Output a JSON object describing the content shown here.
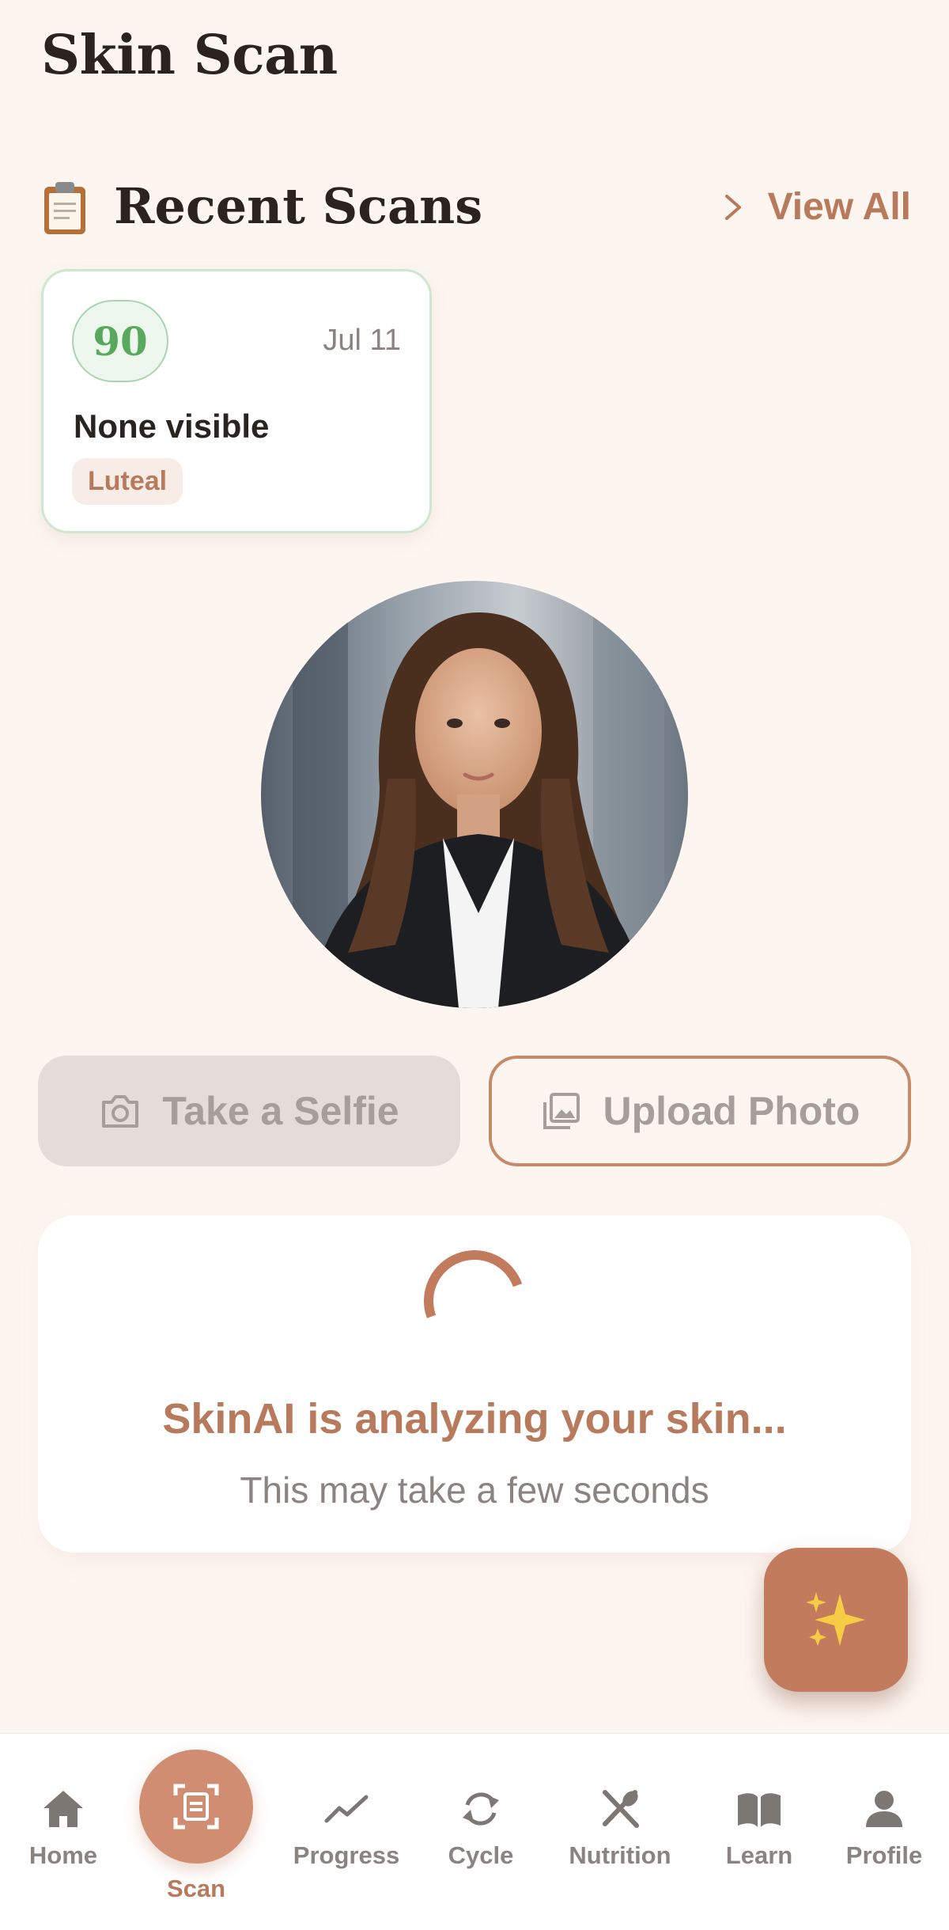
{
  "header": {
    "title": "Skin Scan"
  },
  "recent_scans": {
    "title": "Recent Scans",
    "icon": "clipboard-icon",
    "view_all_label": "View All",
    "items": [
      {
        "score": "90",
        "date": "Jul 11",
        "label": "None visible",
        "phase": "Luteal"
      }
    ]
  },
  "actions": {
    "selfie_label": "Take a Selfie",
    "upload_label": "Upload Photo"
  },
  "analysis": {
    "title": "SkinAI is analyzing your skin...",
    "subtitle": "This may take a few seconds"
  },
  "fab": {
    "icon": "sparkles-icon"
  },
  "nav": {
    "items": [
      {
        "label": "Home",
        "icon": "home-icon"
      },
      {
        "label": "Scan",
        "icon": "scan-icon",
        "active": true
      },
      {
        "label": "Progress",
        "icon": "trend-icon"
      },
      {
        "label": "Cycle",
        "icon": "cycle-icon"
      },
      {
        "label": "Nutrition",
        "icon": "utensils-icon"
      },
      {
        "label": "Learn",
        "icon": "book-icon"
      },
      {
        "label": "Profile",
        "icon": "person-icon"
      }
    ]
  },
  "colors": {
    "background": "#fdf6f0",
    "accent": "#c27b5d",
    "score_green": "#58a85e",
    "muted_text": "#8a837f"
  }
}
